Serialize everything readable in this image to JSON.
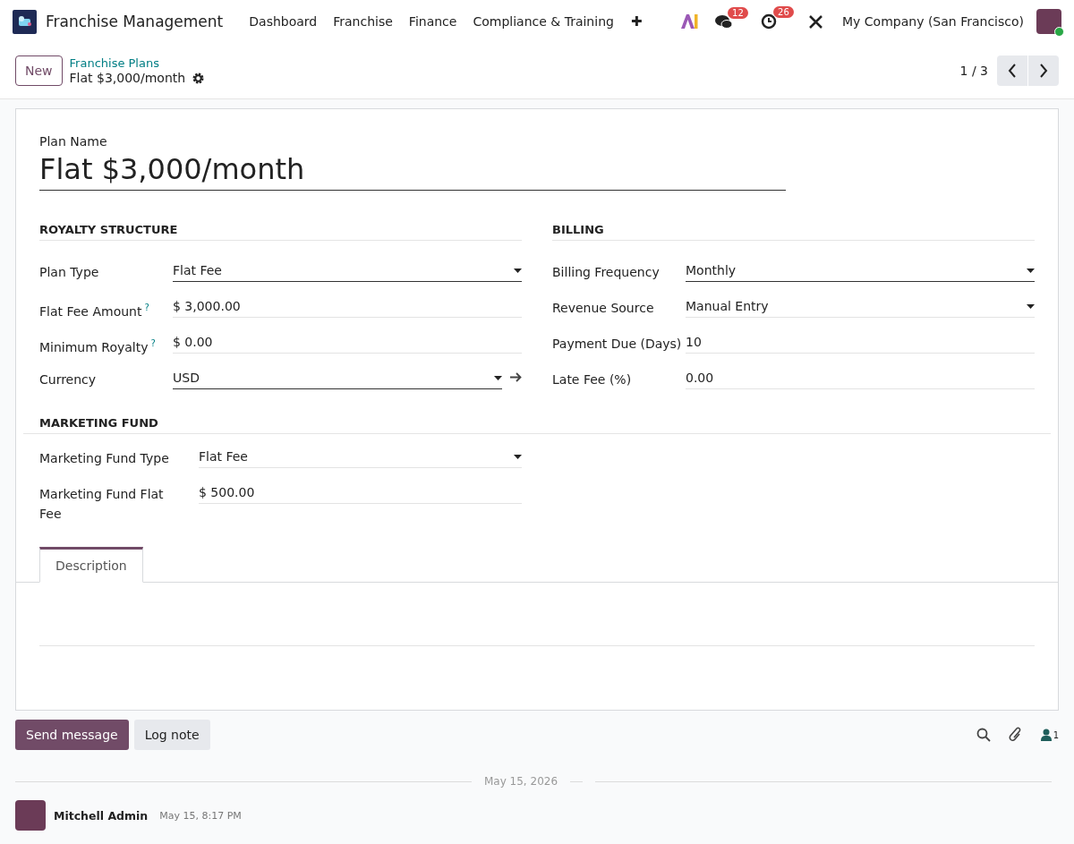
{
  "navbar": {
    "app_name": "Franchise Management",
    "menus": [
      "Dashboard",
      "Franchise",
      "Finance",
      "Compliance & Training"
    ],
    "plus": "✚",
    "messages_badge": "12",
    "activities_badge": "26",
    "company": "My Company (San Francisco)"
  },
  "control_panel": {
    "new_button": "New",
    "breadcrumb": "Franchise Plans",
    "record_title": "Flat $3,000/month",
    "pager": "1 / 3"
  },
  "form": {
    "name_label": "Plan Name",
    "name_value": "Flat $3,000/month",
    "groups": [
      {
        "title": "ROYALTY STRUCTURE",
        "fields": [
          {
            "label": "Plan Type",
            "kind": "select",
            "value": "Flat Fee",
            "required": true
          },
          {
            "label": "Flat Fee Amount",
            "help": "?",
            "kind": "text",
            "value": "$ 3,000.00",
            "required": false
          },
          {
            "label": "Minimum Royalty",
            "help": "?",
            "kind": "text",
            "value": "$ 0.00",
            "required": false
          },
          {
            "label": "Currency",
            "kind": "link",
            "value": "USD",
            "required": true
          }
        ]
      },
      {
        "title": "BILLING",
        "fields": [
          {
            "label": "Billing Frequency",
            "kind": "select",
            "value": "Monthly",
            "required": true
          },
          {
            "label": "Revenue Source",
            "kind": "select",
            "value": "Manual Entry",
            "required": false
          },
          {
            "label": "Payment Due (Days)",
            "kind": "text",
            "value": "10",
            "required": false
          },
          {
            "label": "Late Fee (%)",
            "kind": "text",
            "value": "0.00",
            "required": false
          }
        ]
      }
    ],
    "marketing": {
      "title": "MARKETING FUND",
      "fields": [
        {
          "label": "Marketing Fund Type",
          "kind": "select",
          "value": "Flat Fee",
          "required": false
        },
        {
          "label": "Marketing Fund Flat Fee",
          "kind": "text",
          "value": "$ 500.00",
          "required": false
        }
      ]
    },
    "tabs": [
      {
        "label": "Description",
        "selected": true
      }
    ]
  },
  "chatter": {
    "send_button": "Send message",
    "log_button": "Log note",
    "followers_count": "1",
    "date_separator": "May 15, 2026",
    "messages": [
      {
        "author": "Mitchell Admin",
        "time": "May 15, 8:17 PM"
      }
    ]
  }
}
